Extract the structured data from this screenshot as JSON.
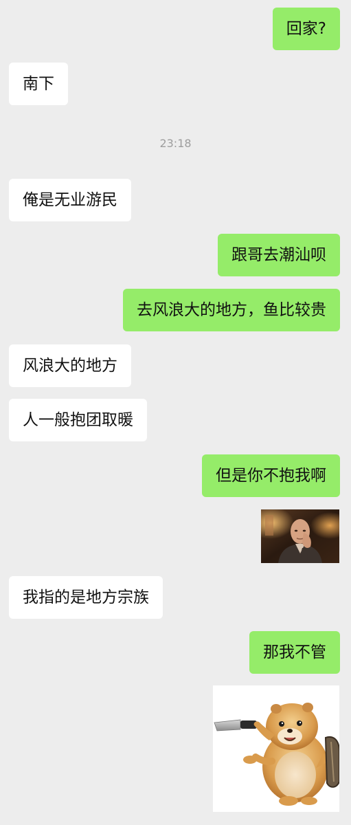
{
  "messages": [
    {
      "side": "right",
      "text": "回家?"
    },
    {
      "side": "left",
      "text": "南下"
    },
    {
      "type": "time",
      "text": "23:18"
    },
    {
      "side": "left",
      "text": "俺是无业游民"
    },
    {
      "side": "right",
      "text": "跟哥去潮汕呗"
    },
    {
      "side": "right",
      "text": "去风浪大的地方，鱼比较贵"
    },
    {
      "side": "left",
      "text": "风浪大的地方"
    },
    {
      "side": "left",
      "text": "人一般抱团取暖"
    },
    {
      "side": "right",
      "text": "但是你不抱我啊"
    },
    {
      "side": "right",
      "type": "image",
      "description": "man-face-sticker"
    },
    {
      "side": "left",
      "text": "我指的是地方宗族"
    },
    {
      "side": "right",
      "text": "那我不管"
    },
    {
      "side": "right",
      "type": "image",
      "description": "hamster-knife-sticker"
    }
  ],
  "colors": {
    "background": "#ededed",
    "bubble_mine": "#95ec69",
    "bubble_theirs": "#ffffff",
    "timestamp": "#9d9d9d"
  }
}
